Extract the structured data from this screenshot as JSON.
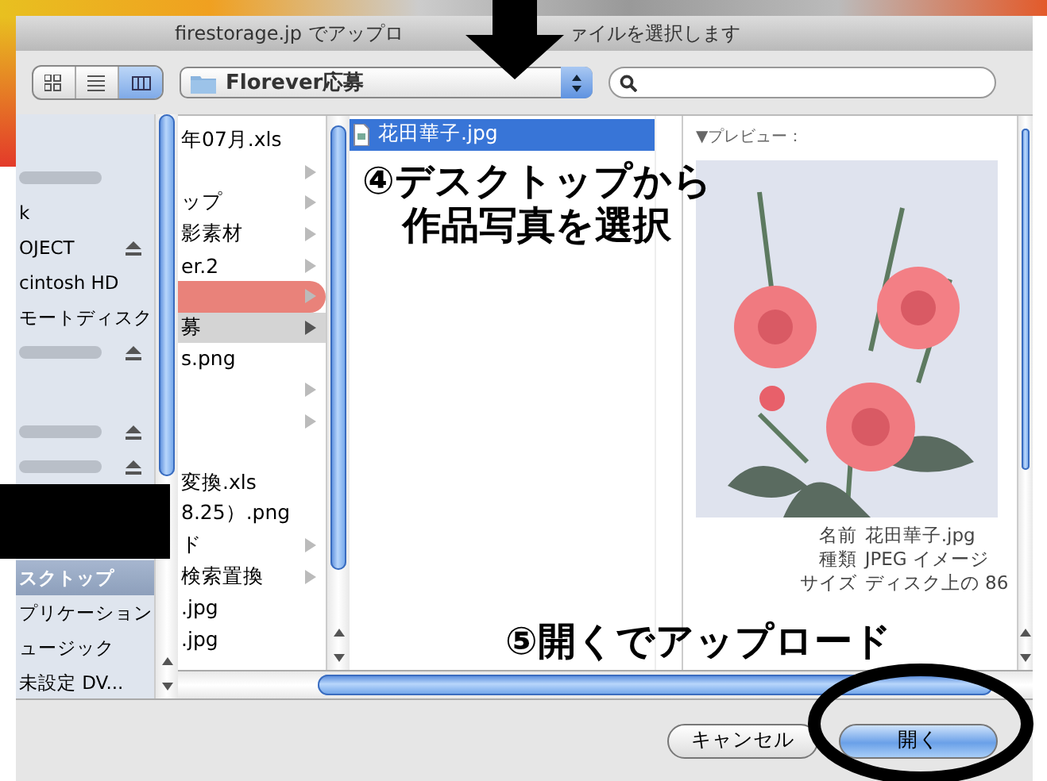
{
  "window": {
    "title_parts": [
      "firestorage.jp でアップロ",
      "ァイルを選択します"
    ]
  },
  "toolbar": {
    "view_buttons": [
      {
        "kind": "icons",
        "selected": false
      },
      {
        "kind": "list",
        "selected": false
      },
      {
        "kind": "columns",
        "selected": true
      }
    ],
    "path_popup": {
      "value": "Florever応募"
    }
  },
  "sidebar": {
    "groups": [
      {
        "items": [
          {
            "kind": "blurred",
            "eject": false,
            "selected": false
          },
          {
            "kind": "text",
            "label": "k",
            "eject": false,
            "selected": false
          },
          {
            "kind": "text",
            "label": "OJECT",
            "eject": true,
            "selected": false
          },
          {
            "kind": "text",
            "label": "cintosh HD",
            "eject": false,
            "selected": false
          },
          {
            "kind": "text",
            "label": "モートディスク",
            "eject": false,
            "selected": false
          },
          {
            "kind": "blurred",
            "eject": true,
            "selected": false
          }
        ]
      },
      {
        "items": [
          {
            "kind": "blurred",
            "eject": true,
            "selected": false
          },
          {
            "kind": "blurred",
            "eject": true,
            "selected": false
          }
        ]
      },
      {
        "items": [
          {
            "kind": "text",
            "label": "スクトップ",
            "eject": false,
            "selected": true
          },
          {
            "kind": "text",
            "label": "プリケーション",
            "eject": false,
            "selected": false
          },
          {
            "kind": "text",
            "label": "ュージック",
            "eject": false,
            "selected": false
          },
          {
            "kind": "text",
            "label": "未設定 DV...",
            "eject": false,
            "selected": false
          }
        ]
      }
    ]
  },
  "columns": [
    {
      "items": [
        {
          "name": "年07月.xls",
          "kind": "file",
          "selected": false
        },
        {
          "kind": "folder",
          "selected": false
        },
        {
          "name": "ップ",
          "kind": "folder",
          "selected": false
        },
        {
          "name": "影素材",
          "kind": "folder",
          "selected": false
        },
        {
          "name": "er.2",
          "kind": "folder",
          "selected": false
        },
        {
          "kind": "folder",
          "selected": false,
          "color": "#e9827a"
        },
        {
          "name": "募",
          "kind": "folder",
          "selected": true
        },
        {
          "name": "s.png",
          "kind": "file",
          "selected": false
        },
        {
          "kind": "folder",
          "selected": false
        },
        {
          "kind": "folder",
          "selected": false
        },
        {
          "kind": "file",
          "selected": false
        },
        {
          "name": "変換.xls",
          "kind": "file",
          "selected": false
        },
        {
          "name": "8.25）.png",
          "kind": "file",
          "selected": false
        },
        {
          "name": "ド",
          "kind": "folder",
          "selected": false
        },
        {
          "name": "検索置換",
          "kind": "folder",
          "selected": false
        },
        {
          "name": ".jpg",
          "kind": "file",
          "selected": false
        },
        {
          "name": ".jpg",
          "kind": "file",
          "selected": false
        }
      ]
    },
    {
      "items": [
        {
          "name": "花田華子.jpg",
          "kind": "file",
          "selected": true
        }
      ]
    }
  ],
  "preview": {
    "heading": "▼プレビュー：",
    "info": [
      {
        "label": "名前",
        "value": "花田華子.jpg"
      },
      {
        "label": "種類",
        "value": "JPEG イメージ"
      },
      {
        "label": "サイズ",
        "value": "ディスク上の 86"
      }
    ]
  },
  "buttons": [
    {
      "label": "キャンセル",
      "default": false
    },
    {
      "label": "開く",
      "default": true
    }
  ],
  "annotations": [
    {
      "kind": "arrow"
    },
    {
      "kind": "note",
      "lines": [
        "④デスクトップから",
        "作品写真を選択"
      ]
    },
    {
      "kind": "note",
      "lines": [
        "⑤開くでアップロード"
      ]
    },
    {
      "kind": "ellipse"
    },
    {
      "kind": "redaction"
    }
  ]
}
